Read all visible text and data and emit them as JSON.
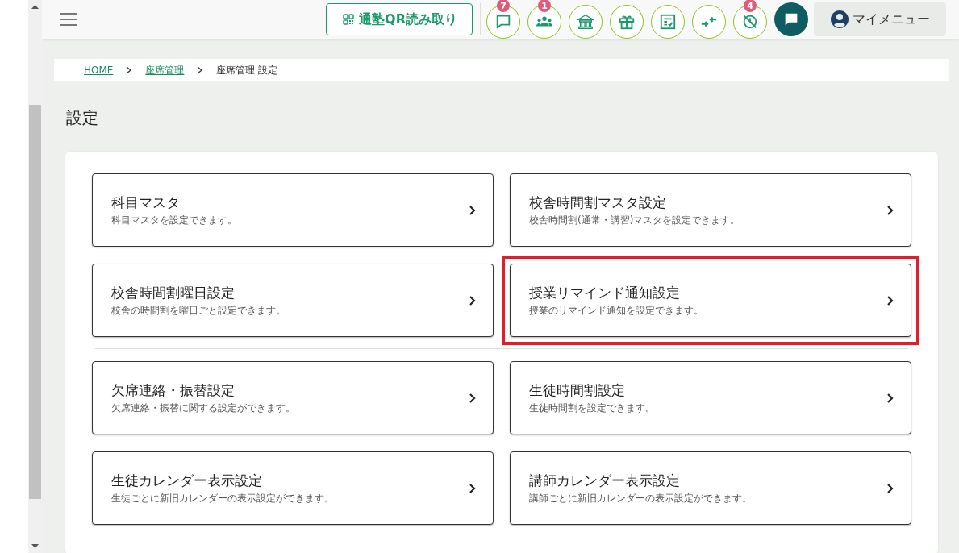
{
  "header": {
    "qr_button": "通塾QR読み取り",
    "icon_buttons": [
      {
        "kind": "chat",
        "badge": "7"
      },
      {
        "kind": "group",
        "badge": "1"
      },
      {
        "kind": "school"
      },
      {
        "kind": "gift"
      },
      {
        "kind": "checklist"
      },
      {
        "kind": "merge"
      },
      {
        "kind": "clockoff",
        "badge": "4"
      }
    ],
    "my_menu": "マイメニュー"
  },
  "breadcrumb": [
    {
      "label": "HOME",
      "link": true
    },
    {
      "label": "座席管理",
      "link": true
    },
    {
      "label": "座席管理 設定",
      "link": false
    }
  ],
  "page_title": "設定",
  "sections": [
    {
      "items": [
        {
          "title": "科目マスタ",
          "description": "科目マスタを設定できます。",
          "highlighted": false
        },
        {
          "title": "校舎時間割マスタ設定",
          "description": "校舎時間割(通常・講習)マスタを設定できます。",
          "highlighted": false
        },
        {
          "title": "校舎時間割曜日設定",
          "description": "校舎の時間割を曜日ごと設定できます。",
          "highlighted": false
        },
        {
          "title": "授業リマインド通知設定",
          "description": "授業のリマインド通知を設定できます。",
          "highlighted": true
        }
      ]
    },
    {
      "items": [
        {
          "title": "欠席連絡・振替設定",
          "description": "欠席連絡・振替に関する設定ができます。",
          "highlighted": false
        },
        {
          "title": "生徒時間割設定",
          "description": "生徒時間割を設定できます。",
          "highlighted": false
        },
        {
          "title": "生徒カレンダー表示設定",
          "description": "生徒ごとに新旧カレンダーの表示設定ができます。",
          "highlighted": false
        },
        {
          "title": "講師カレンダー表示設定",
          "description": "講師ごとに新旧カレンダーの表示設定ができます。",
          "highlighted": false
        }
      ]
    }
  ]
}
